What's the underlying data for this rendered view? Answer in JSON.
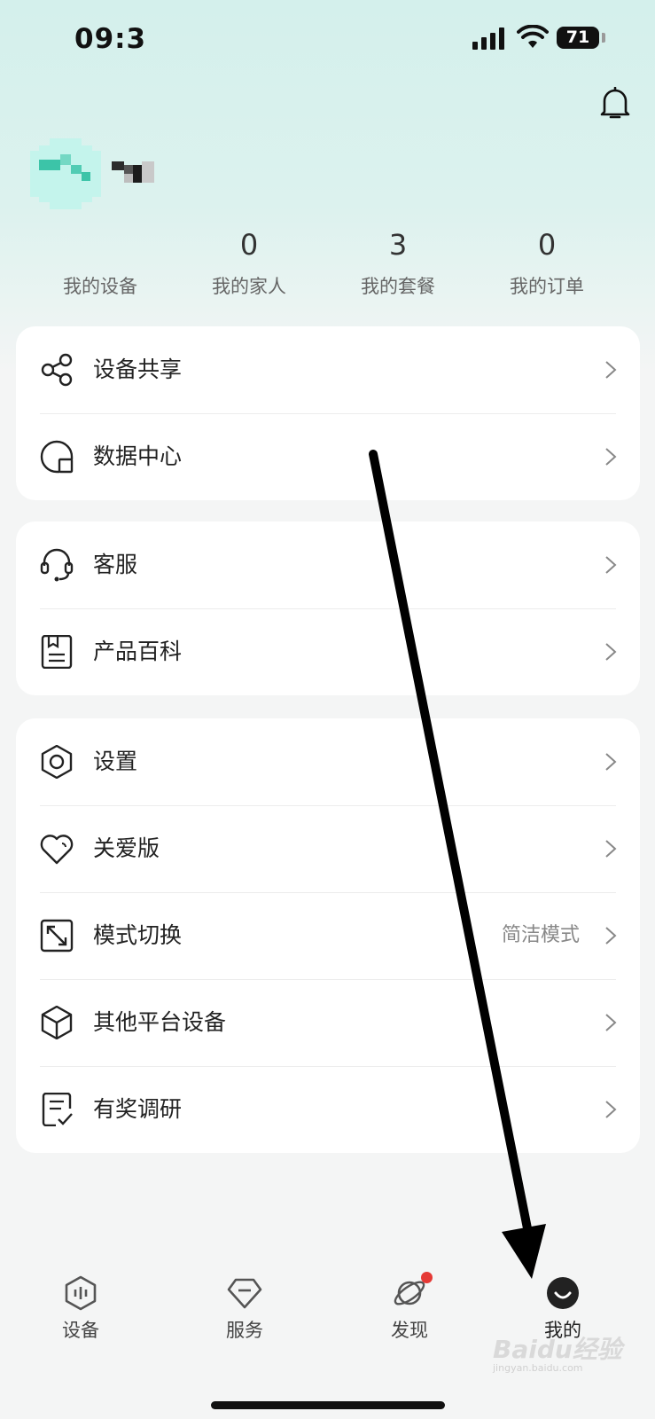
{
  "status_bar": {
    "time": "09:3",
    "battery": "71"
  },
  "stats": [
    {
      "value": "",
      "label": "我的设备"
    },
    {
      "value": "0",
      "label": "我的家人"
    },
    {
      "value": "3",
      "label": "我的套餐"
    },
    {
      "value": "0",
      "label": "我的订单"
    }
  ],
  "groups": {
    "g1": [
      {
        "label": "设备共享",
        "icon": "share-icon"
      },
      {
        "label": "数据中心",
        "icon": "data-center-icon"
      }
    ],
    "g2": [
      {
        "label": "客服",
        "icon": "headset-icon"
      },
      {
        "label": "产品百科",
        "icon": "book-icon"
      }
    ],
    "g3": [
      {
        "label": "设置",
        "icon": "settings-hexagon-icon"
      },
      {
        "label": "关爱版",
        "icon": "heart-icon"
      },
      {
        "label": "模式切换",
        "icon": "mode-switch-icon",
        "value": "简洁模式"
      },
      {
        "label": "其他平台设备",
        "icon": "cube-icon"
      },
      {
        "label": "有奖调研",
        "icon": "survey-icon"
      }
    ]
  },
  "tabbar": [
    {
      "label": "设备",
      "icon": "device-tab-icon"
    },
    {
      "label": "服务",
      "icon": "service-tab-icon"
    },
    {
      "label": "发现",
      "icon": "discover-planet-icon"
    },
    {
      "label": "我的",
      "icon": "profile-smile-icon",
      "active": true
    }
  ],
  "watermark": {
    "brand": "Baidu经验",
    "url": "jingyan.baidu.com"
  },
  "colors": {
    "hero_bg": "#d4f0ec",
    "page_bg": "#f4f5f5",
    "card_bg": "#ffffff",
    "badge_red": "#e53935",
    "arrow": "#000000"
  }
}
